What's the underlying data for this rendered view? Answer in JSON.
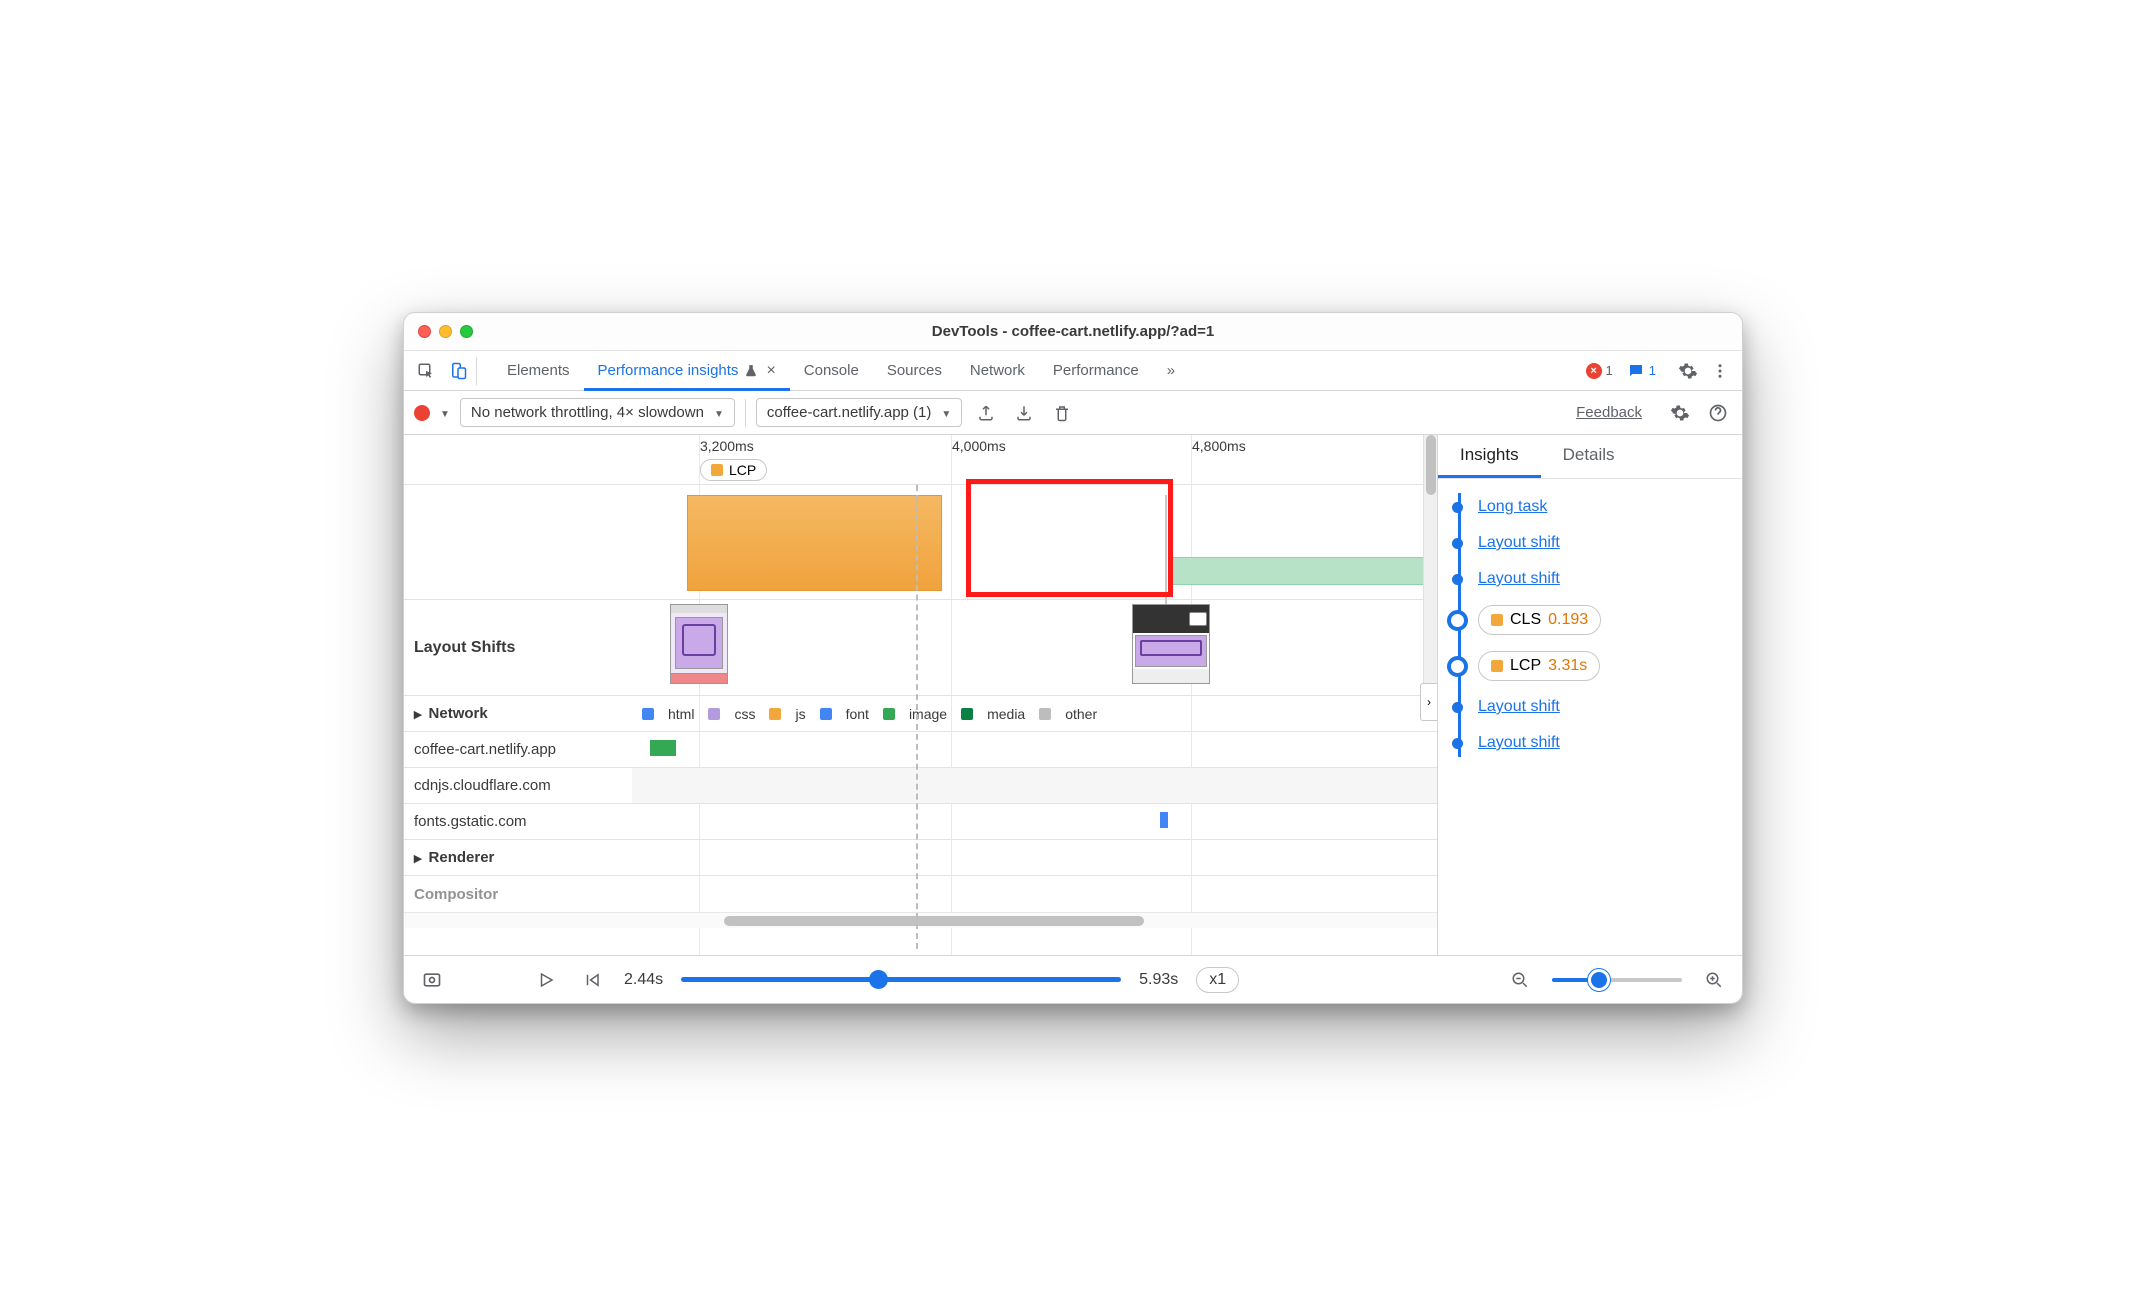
{
  "window": {
    "title": "DevTools - coffee-cart.netlify.app/?ad=1"
  },
  "tabs": {
    "items": [
      "Elements",
      "Performance insights",
      "Console",
      "Sources",
      "Network",
      "Performance"
    ],
    "active": "Performance insights",
    "overflow": "»",
    "error_count": "1",
    "message_count": "1"
  },
  "toolbar": {
    "throttle": "No network throttling, 4× slowdown",
    "page_select": "coffee-cart.netlify.app (1)",
    "feedback": "Feedback"
  },
  "timeline": {
    "ticks": [
      {
        "label": "3,200ms",
        "pos": 68
      },
      {
        "label": "4,000ms",
        "pos": 320
      },
      {
        "label": "4,800ms",
        "pos": 560
      }
    ],
    "lcp_chip": "LCP"
  },
  "sections": {
    "layout_shifts": "Layout Shifts",
    "network": "Network",
    "renderer": "Renderer",
    "compositor": "Compositor"
  },
  "net_legend": {
    "html": "html",
    "css": "css",
    "js": "js",
    "font": "font",
    "image": "image",
    "media": "media",
    "other": "other"
  },
  "net_rows": [
    {
      "host": "coffee-cart.netlify.app"
    },
    {
      "host": "cdnjs.cloudflare.com"
    },
    {
      "host": "fonts.gstatic.com"
    }
  ],
  "right": {
    "tabs": {
      "insights": "Insights",
      "details": "Details"
    },
    "items": [
      {
        "kind": "link",
        "text": "Long task"
      },
      {
        "kind": "link",
        "text": "Layout shift"
      },
      {
        "kind": "link",
        "text": "Layout shift"
      },
      {
        "kind": "chip",
        "label": "CLS",
        "value": "0.193",
        "color": "#f2a73b"
      },
      {
        "kind": "chip",
        "label": "LCP",
        "value": "3.31s",
        "color": "#f2a73b"
      },
      {
        "kind": "link",
        "text": "Layout shift"
      },
      {
        "kind": "link",
        "text": "Layout shift"
      }
    ]
  },
  "footer": {
    "start": "2.44s",
    "end": "5.93s",
    "speed": "x1"
  }
}
